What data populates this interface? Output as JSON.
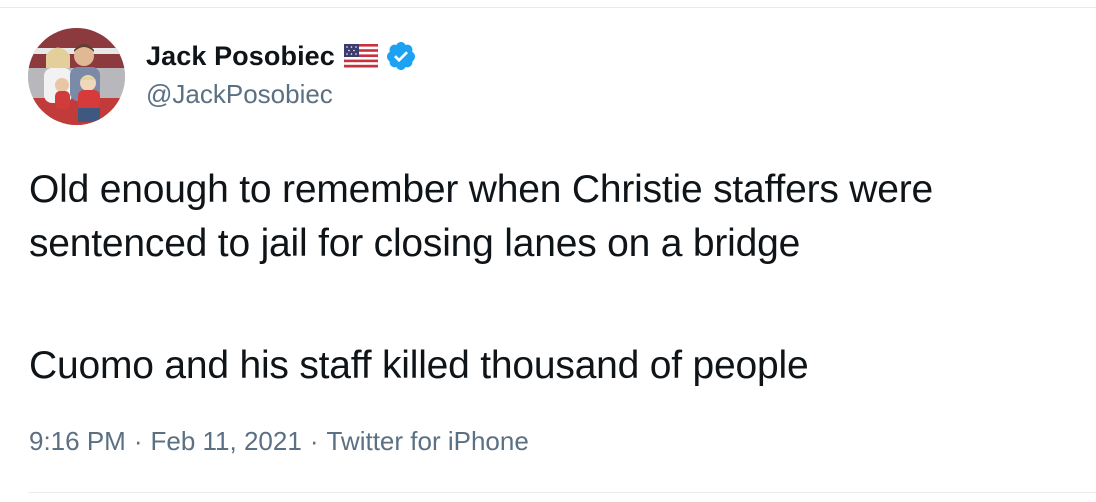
{
  "author": {
    "display_name": "Jack Posobiec",
    "handle": "@JackPosobiec",
    "flag_icon": "us-flag-icon",
    "verified_icon": "verified-badge-icon"
  },
  "tweet": {
    "text_line1": "Old enough to remember when Christie staffers were",
    "text_line2": "sentenced to jail for closing lanes on a bridge",
    "text_line3": "Cuomo and his staff killed thousand of people"
  },
  "meta": {
    "time": "9:16 PM",
    "separator": "·",
    "date": "Feb 11, 2021",
    "source": "Twitter for iPhone"
  },
  "colors": {
    "text": "#0f1419",
    "secondary": "#5b7083",
    "verified": "#1da1f2",
    "divider": "#e6ecf0"
  }
}
